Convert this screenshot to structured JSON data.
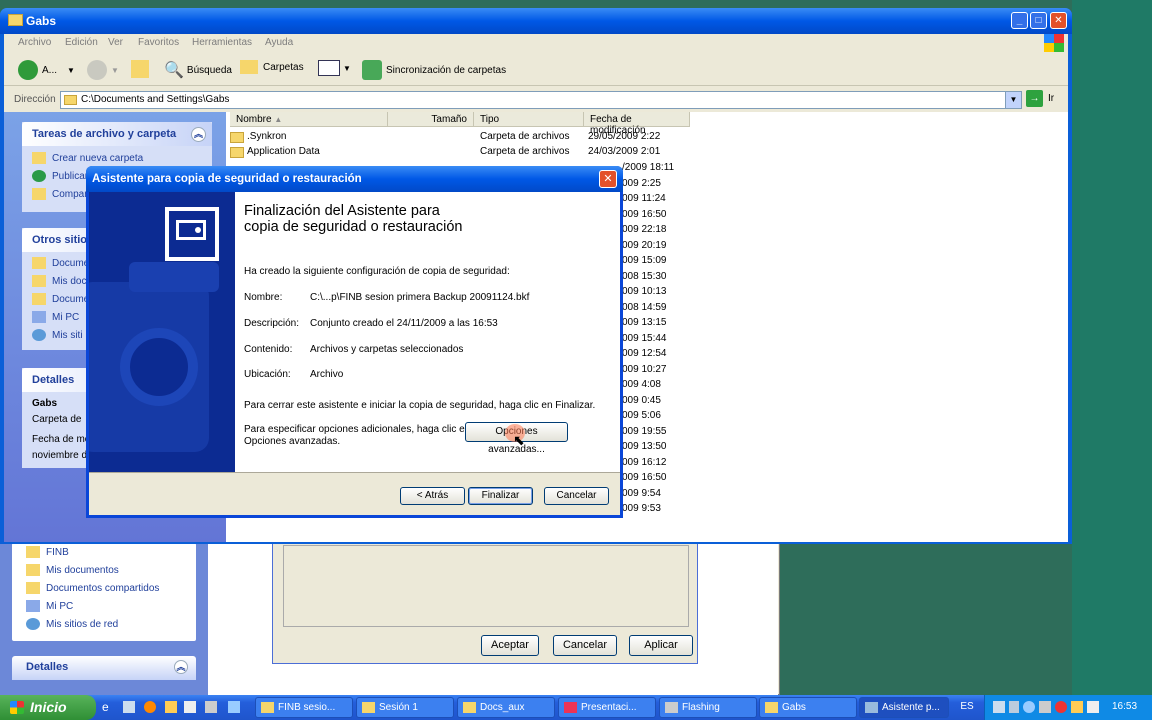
{
  "window": {
    "title": "Gabs",
    "menu": [
      "Archivo",
      "Edición",
      "Ver",
      "Favoritos",
      "Herramientas",
      "Ayuda"
    ],
    "toolbar": {
      "back": "A...",
      "search": "Búsqueda",
      "folders": "Carpetas",
      "sync": "Sincronización de carpetas"
    },
    "address_label": "Dirección",
    "address": "C:\\Documents and Settings\\Gabs",
    "go": "Ir"
  },
  "left_pane": {
    "tasks_title": "Tareas de archivo y carpeta",
    "tasks": [
      "Crear nueva carpeta",
      "Publicar",
      "Compar"
    ],
    "other_title": "Otros sitio",
    "other": [
      "Docume",
      "Mis docu",
      "Docume",
      "Mi PC",
      "Mis siti"
    ],
    "details_title": "Detalles",
    "details_name": "Gabs",
    "details_type": "Carpeta de",
    "details_date1": "Fecha de mo",
    "details_date2": "noviembre d"
  },
  "columns": {
    "name": "Nombre",
    "size": "Tamaño",
    "type": "Tipo",
    "modified": "Fecha de modificación"
  },
  "files": [
    {
      "name": ".Synkron",
      "type": "Carpeta de archivos",
      "date": "29/05/2009 2:22"
    },
    {
      "name": "Application Data",
      "type": "Carpeta de archivos",
      "date": "24/03/2009 2:01"
    }
  ],
  "dates_partial": [
    "/2009 18:11",
    "009 2:25",
    "009 11:24",
    "009 16:50",
    "009 22:18",
    "009 20:19",
    "009 15:09",
    "008 15:30",
    "009 10:13",
    "008 14:59",
    "009 13:15",
    "009 15:44",
    "009 12:54",
    "009 10:27",
    "009 4:08",
    "009 0:45",
    "009 5:06",
    "009 19:55",
    "009 13:50",
    "009 16:12",
    "009 16:50",
    "009 9:54",
    "009 9:53"
  ],
  "wizard": {
    "title": "Asistente para copia de seguridad o restauración",
    "heading1": "Finalización del Asistente para",
    "heading2": "copia de seguridad o restauración",
    "intro": "Ha creado la siguiente configuración de copia de seguridad:",
    "name_label": "Nombre:",
    "name_value": "C:\\...p\\FINB sesion primera Backup 20091124.bkf",
    "desc_label": "Descripción:",
    "desc_value": "Conjunto creado el 24/11/2009 a las 16:53",
    "content_label": "Contenido:",
    "content_value": "Archivos y carpetas seleccionados",
    "loc_label": "Ubicación:",
    "loc_value": "Archivo",
    "finish_text": "Para cerrar este asistente e iniciar la copia de seguridad, haga clic en Finalizar.",
    "adv_text1": "Para especificar opciones adicionales, haga clic en",
    "adv_text2": "Opciones avanzadas.",
    "adv_button": "Opciones avanzadas...",
    "back_button": "< Atrás",
    "finish_button": "Finalizar",
    "cancel_button": "Cancelar"
  },
  "bg_window": {
    "items": [
      "FINB",
      "Mis documentos",
      "Documentos compartidos",
      "Mi PC",
      "Mis sitios de red"
    ],
    "details": "Detalles",
    "accept": "Aceptar",
    "cancel": "Cancelar",
    "apply": "Aplicar"
  },
  "taskbar": {
    "start": "Inicio",
    "items": [
      "FINB sesio...",
      "Sesión 1",
      "Docs_aux",
      "Presentaci...",
      "Flashing",
      "Gabs",
      "Asistente p..."
    ],
    "lang": "ES",
    "clock": "16:53"
  }
}
